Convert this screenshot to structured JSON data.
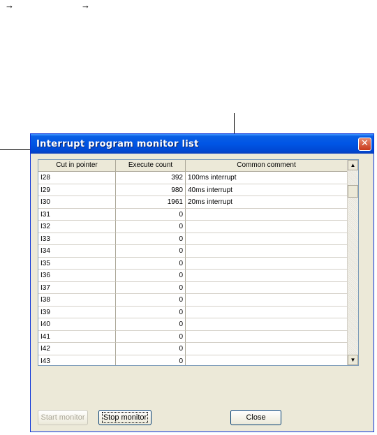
{
  "annotations": {
    "arrow_left": "→",
    "arrow_right": "→"
  },
  "window": {
    "title": "Interrupt program monitor list",
    "close_glyph": "✕"
  },
  "table": {
    "columns": [
      "Cut in pointer",
      "Execute count",
      "Common comment"
    ],
    "rows": [
      {
        "pointer": "I28",
        "count": "392",
        "comment": "100ms interrupt"
      },
      {
        "pointer": "I29",
        "count": "980",
        "comment": "40ms interrupt"
      },
      {
        "pointer": "I30",
        "count": "1961",
        "comment": "20ms interrupt"
      },
      {
        "pointer": "I31",
        "count": "0",
        "comment": ""
      },
      {
        "pointer": "I32",
        "count": "0",
        "comment": ""
      },
      {
        "pointer": "I33",
        "count": "0",
        "comment": ""
      },
      {
        "pointer": "I34",
        "count": "0",
        "comment": ""
      },
      {
        "pointer": "I35",
        "count": "0",
        "comment": ""
      },
      {
        "pointer": "I36",
        "count": "0",
        "comment": ""
      },
      {
        "pointer": "I37",
        "count": "0",
        "comment": ""
      },
      {
        "pointer": "I38",
        "count": "0",
        "comment": ""
      },
      {
        "pointer": "I39",
        "count": "0",
        "comment": ""
      },
      {
        "pointer": "I40",
        "count": "0",
        "comment": ""
      },
      {
        "pointer": "I41",
        "count": "0",
        "comment": ""
      },
      {
        "pointer": "I42",
        "count": "0",
        "comment": ""
      },
      {
        "pointer": "I43",
        "count": "0",
        "comment": ""
      }
    ],
    "scroll_up_glyph": "▲",
    "scroll_down_glyph": "▼"
  },
  "buttons": {
    "start_monitor": "Start monitor",
    "stop_monitor": "Stop monitor",
    "close": "Close"
  }
}
